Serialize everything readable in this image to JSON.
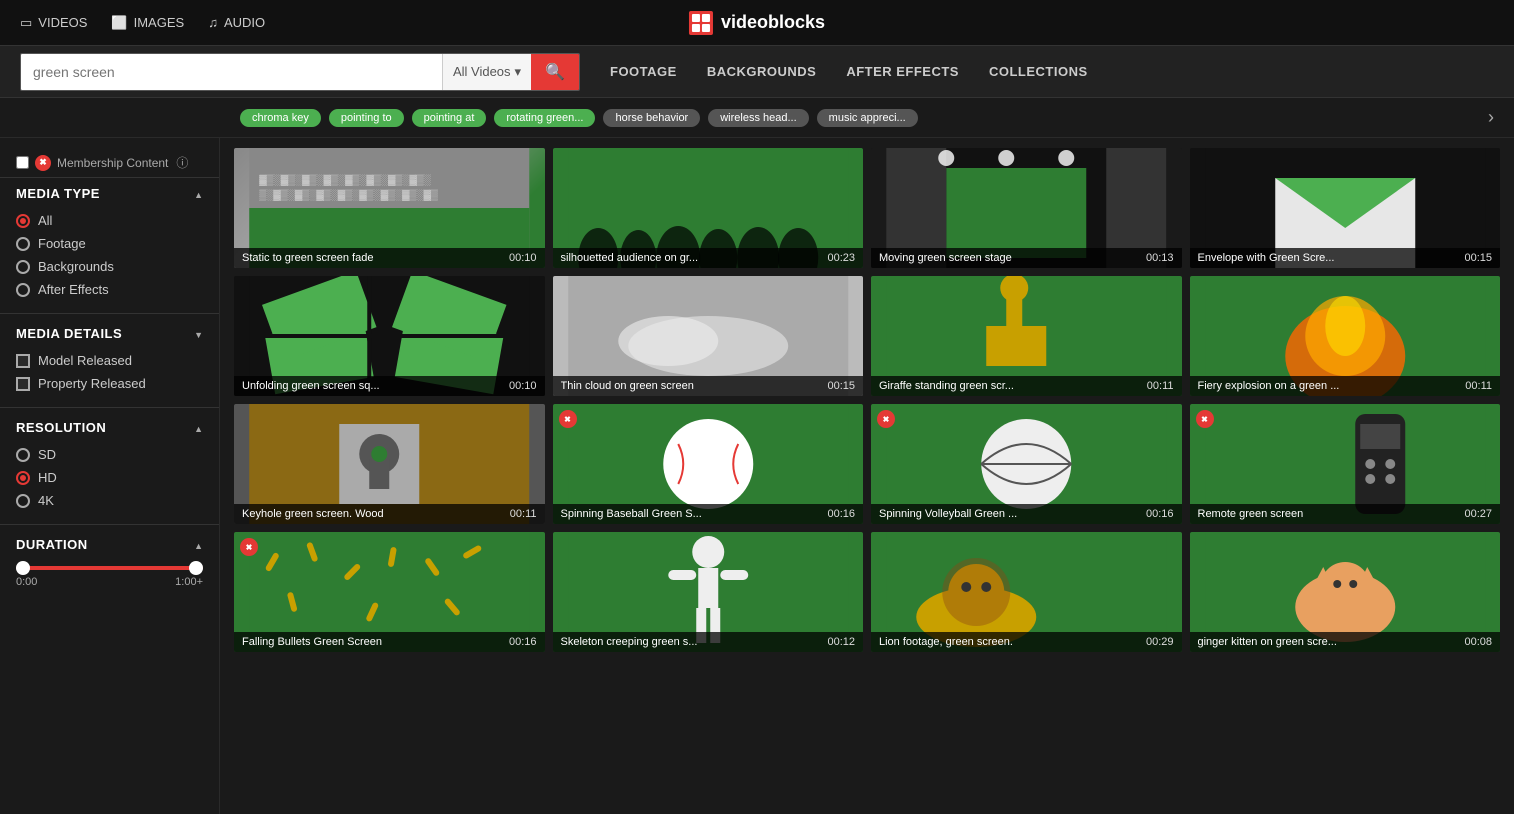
{
  "topnav": {
    "items": [
      {
        "label": "VIDEOS",
        "icon": "video-icon"
      },
      {
        "label": "IMAGES",
        "icon": "image-icon"
      },
      {
        "label": "AUDIO",
        "icon": "audio-icon"
      }
    ],
    "logo_text": "videoblocks"
  },
  "search": {
    "placeholder": "green screen",
    "dropdown_label": "All Videos",
    "nav_links": [
      "FOOTAGE",
      "BACKGROUNDS",
      "AFTER EFFECTS",
      "COLLECTIONS"
    ]
  },
  "tags": {
    "items": [
      {
        "label": "chroma key",
        "color": "green"
      },
      {
        "label": "pointing to",
        "color": "green"
      },
      {
        "label": "pointing at",
        "color": "green"
      },
      {
        "label": "rotating green...",
        "color": "green"
      },
      {
        "label": "horse behavior",
        "color": "gray"
      },
      {
        "label": "wireless head...",
        "color": "gray"
      },
      {
        "label": "music appreci...",
        "color": "gray"
      }
    ]
  },
  "sidebar": {
    "membership": {
      "label": "Membership Content",
      "badge": "i"
    },
    "media_type": {
      "title": "Media Type",
      "items": [
        {
          "label": "All",
          "selected": true
        },
        {
          "label": "Footage"
        },
        {
          "label": "Backgrounds"
        },
        {
          "label": "After Effects"
        }
      ]
    },
    "media_details": {
      "title": "Media Details",
      "items": [
        {
          "label": "Model Released"
        },
        {
          "label": "Property Released"
        }
      ]
    },
    "resolution": {
      "title": "Resolution",
      "items": [
        {
          "label": "SD"
        },
        {
          "label": "HD",
          "selected": true
        },
        {
          "label": "4K"
        }
      ]
    },
    "duration": {
      "title": "Duration",
      "min_label": "0:00",
      "max_label": "1:00+"
    }
  },
  "videos": [
    {
      "title": "Static to green screen fade",
      "duration": "00:10",
      "thumb_class": "thumb-static",
      "member": false,
      "row": 1
    },
    {
      "title": "silhouetted audience on gr...",
      "duration": "00:23",
      "thumb_class": "thumb-silhouette",
      "member": false,
      "row": 1
    },
    {
      "title": "Moving green screen stage",
      "duration": "00:13",
      "thumb_class": "thumb-stage",
      "member": false,
      "row": 1
    },
    {
      "title": "Envelope with Green Scre...",
      "duration": "00:15",
      "thumb_class": "thumb-envelope",
      "member": false,
      "row": 1
    },
    {
      "title": "Unfolding green screen sq...",
      "duration": "00:10",
      "thumb_class": "thumb-unfold",
      "member": false,
      "row": 2
    },
    {
      "title": "Thin cloud on green screen",
      "duration": "00:15",
      "thumb_class": "thumb-cloud",
      "member": false,
      "row": 2
    },
    {
      "title": "Giraffe standing green scr...",
      "duration": "00:11",
      "thumb_class": "thumb-giraffe",
      "member": false,
      "row": 2
    },
    {
      "title": "Fiery explosion on a green ...",
      "duration": "00:11",
      "thumb_class": "thumb-fire",
      "member": false,
      "row": 2
    },
    {
      "title": "Keyhole green screen. Wood",
      "duration": "00:11",
      "thumb_class": "thumb-keyhole",
      "member": false,
      "row": 3
    },
    {
      "title": "Spinning Baseball Green S...",
      "duration": "00:16",
      "thumb_class": "thumb-baseball",
      "member": true,
      "row": 3
    },
    {
      "title": "Spinning Volleyball Green ...",
      "duration": "00:16",
      "thumb_class": "thumb-volleyball",
      "member": true,
      "row": 3
    },
    {
      "title": "Remote green screen",
      "duration": "00:27",
      "thumb_class": "thumb-remote",
      "member": true,
      "row": 3
    },
    {
      "title": "Falling Bullets Green Screen",
      "duration": "00:16",
      "thumb_class": "thumb-bullets",
      "member": true,
      "row": 4
    },
    {
      "title": "Skeleton creeping green s...",
      "duration": "00:12",
      "thumb_class": "thumb-skeleton",
      "member": false,
      "row": 4
    },
    {
      "title": "Lion footage, green screen.",
      "duration": "00:29",
      "thumb_class": "thumb-lion",
      "member": false,
      "row": 4
    },
    {
      "title": "ginger kitten on green scre...",
      "duration": "00:08",
      "thumb_class": "thumb-kitten",
      "member": false,
      "row": 4
    }
  ]
}
